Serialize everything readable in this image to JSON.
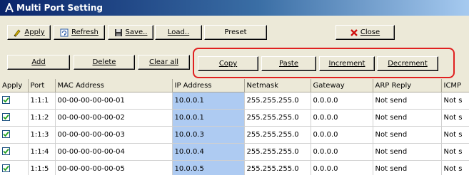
{
  "window": {
    "title": "Multi Port Setting"
  },
  "toolbar": {
    "apply": "Apply",
    "refresh": "Refresh",
    "save": "Save..",
    "load": "Load..",
    "preset": "Preset",
    "close": "Close"
  },
  "edit_toolbar": {
    "add": "Add",
    "delete": "Delete",
    "clear_all": "Clear all",
    "copy": "Copy",
    "paste": "Paste",
    "increment": "Increment",
    "decrement": "Decrement"
  },
  "colors": {
    "highlight": "#e02020",
    "ip_cell": "#aecbf2"
  },
  "table": {
    "columns": [
      "Apply",
      "Port",
      "MAC Address",
      "IP Address",
      "Netmask",
      "Gateway",
      "ARP Reply",
      "ICMP"
    ],
    "rows": [
      {
        "apply": true,
        "port": "1:1:1",
        "mac": "00-00-00-00-00-01",
        "ip": "10.0.0.1",
        "netmask": "255.255.255.0",
        "gateway": "0.0.0.0",
        "arp": "Not send",
        "icmp": "Not s"
      },
      {
        "apply": true,
        "port": "1:1:2",
        "mac": "00-00-00-00-00-02",
        "ip": "10.0.0.1",
        "netmask": "255.255.255.0",
        "gateway": "0.0.0.0",
        "arp": "Not send",
        "icmp": "Not s"
      },
      {
        "apply": true,
        "port": "1:1:3",
        "mac": "00-00-00-00-00-03",
        "ip": "10.0.0.3",
        "netmask": "255.255.255.0",
        "gateway": "0.0.0.0",
        "arp": "Not send",
        "icmp": "Not s"
      },
      {
        "apply": true,
        "port": "1:1:4",
        "mac": "00-00-00-00-00-04",
        "ip": "10.0.0.4",
        "netmask": "255.255.255.0",
        "gateway": "0.0.0.0",
        "arp": "Not send",
        "icmp": "Not s"
      },
      {
        "apply": true,
        "port": "1:1:5",
        "mac": "00-00-00-00-00-05",
        "ip": "10.0.0.5",
        "netmask": "255.255.255.0",
        "gateway": "0.0.0.0",
        "arp": "Not send",
        "icmp": "Not s"
      }
    ]
  }
}
